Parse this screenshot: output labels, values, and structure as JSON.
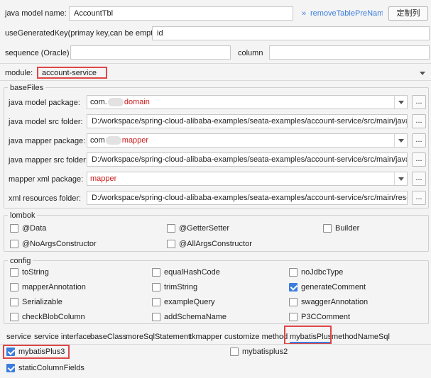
{
  "top": {
    "model_name_label": "java model name:",
    "model_name_value": "AccountTbl",
    "remove_prefix_label": "removeTablePreName",
    "remove_prefix_chevron": "»",
    "button_label": "定制列",
    "use_generated_key_label": "useGeneratedKey(primay key,can be empty):",
    "use_generated_key_value": "id",
    "sequence_label": "sequence (Oracle)",
    "sequence_value": "",
    "column_label": "column",
    "column_value": "",
    "module_label": "module:",
    "module_value": "account-service"
  },
  "baseFiles": {
    "title": "baseFiles",
    "java_model_package_label": "java model package:",
    "java_model_package_prefix": "com.",
    "java_model_package_suffix": "domain",
    "java_model_src_label": "java model src folder:",
    "java_model_src_value": "D:/workspace/spring-cloud-alibaba-examples/seata-examples/account-service/src/main/java",
    "java_mapper_package_label": "java mapper package:",
    "java_mapper_package_prefix": "com",
    "java_mapper_package_suffix": "mapper",
    "java_mapper_src_label": "java mapper src folder:",
    "java_mapper_src_value": "D:/workspace/spring-cloud-alibaba-examples/seata-examples/account-service/src/main/java",
    "mapper_xml_package_label": "mapper xml package:",
    "mapper_xml_package_value": "mapper",
    "xml_resources_label": "xml resources folder:",
    "xml_resources_value": "D:/workspace/spring-cloud-alibaba-examples/seata-examples/account-service/src/main/resources",
    "browse_label": "..."
  },
  "lombok": {
    "title": "lombok",
    "items": [
      {
        "label": "@Data",
        "checked": false
      },
      {
        "label": "@GetterSetter",
        "checked": false
      },
      {
        "label": "Builder",
        "checked": false
      },
      {
        "label": "@NoArgsConstructor",
        "checked": false
      },
      {
        "label": "@AllArgsConstructor",
        "checked": false
      }
    ]
  },
  "config": {
    "title": "config",
    "items": [
      {
        "label": "toString",
        "checked": false
      },
      {
        "label": "equalHashCode",
        "checked": false
      },
      {
        "label": "noJdbcType",
        "checked": false
      },
      {
        "label": "mapperAnnotation",
        "checked": false
      },
      {
        "label": "trimString",
        "checked": false
      },
      {
        "label": "generateComment",
        "checked": true
      },
      {
        "label": "Serializable",
        "checked": false
      },
      {
        "label": "exampleQuery",
        "checked": false
      },
      {
        "label": "swaggerAnnotation",
        "checked": false
      },
      {
        "label": "checkBlobColumn",
        "checked": false
      },
      {
        "label": "addSchemaName",
        "checked": false
      },
      {
        "label": "P3CComment",
        "checked": false
      }
    ]
  },
  "tabs": {
    "items": [
      "service",
      "service interface",
      "baseClass",
      "moreSqlStatement",
      "tkmapper",
      "customize method",
      "mybatisPlus",
      "methodNameSql"
    ],
    "active": "mybatisPlus"
  },
  "mybatisPlus": {
    "items": [
      {
        "label": "mybatisPlus3",
        "checked": true
      },
      {
        "label": "mybatisplus2",
        "checked": false
      },
      {
        "label": "staticColumnFields",
        "checked": true
      }
    ]
  },
  "colors": {
    "accent": "#3b7ddd",
    "highlight": "#e04646",
    "red_text": "#cc1b1b"
  }
}
